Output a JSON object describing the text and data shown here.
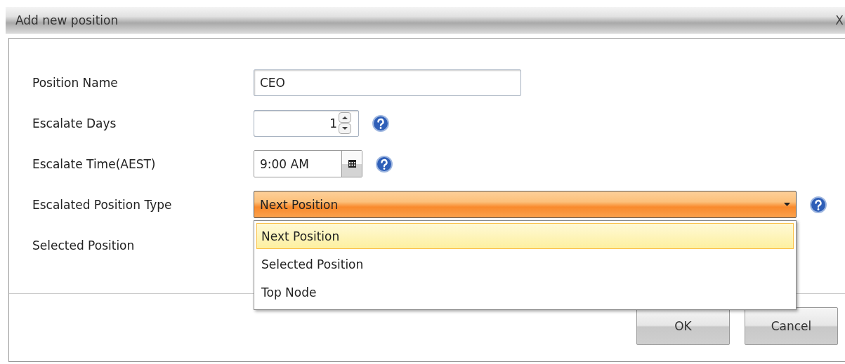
{
  "window": {
    "title": "Add new position",
    "close": "X"
  },
  "fields": [
    {
      "label": "Position Name",
      "kind": "text",
      "value": "CEO"
    },
    {
      "label": "Escalate Days",
      "kind": "spinner",
      "value": "1",
      "help": true
    },
    {
      "label": "Escalate Time(AEST)",
      "kind": "time",
      "value": "9:00 AM",
      "help": true
    },
    {
      "label": "Escalated Position Type",
      "kind": "select",
      "value": "Next Position",
      "help": true,
      "expanded": true,
      "options": [
        {
          "label": "Next Position",
          "selected": true
        },
        {
          "label": "Selected Position",
          "selected": false
        },
        {
          "label": "Top Node",
          "selected": false
        }
      ]
    },
    {
      "label": "Selected Position",
      "kind": "covered"
    }
  ],
  "buttons": [
    "OK",
    "Cancel"
  ]
}
